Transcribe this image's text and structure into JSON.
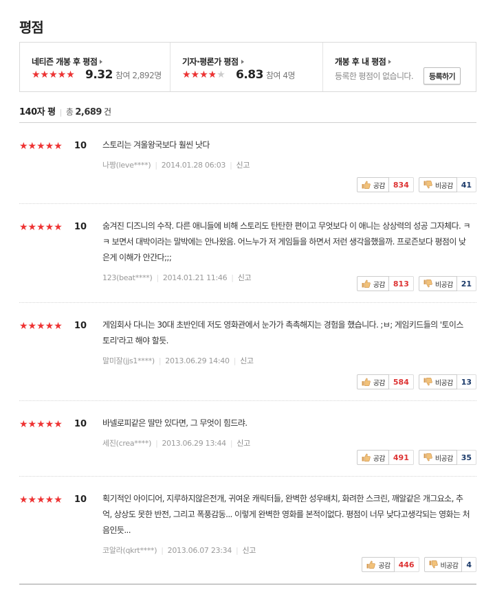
{
  "page_title": "평점",
  "summary": {
    "netizen": {
      "title": "네티즌 개봉 후 평점",
      "score": "9.32",
      "participants": "참여 2,892명",
      "score_fraction": 0.932
    },
    "critic": {
      "title": "기자·평론가 평점",
      "score": "6.83",
      "participants": "참여 4명",
      "score_fraction": 0.683
    },
    "mine": {
      "title": "개봉 후 내 평점",
      "empty_text": "등록한 평점이 없습니다.",
      "register_label": "등록하기"
    }
  },
  "count_line": {
    "label": "140자 평",
    "total_label": "총",
    "total": "2,689",
    "unit": "건"
  },
  "colors": {
    "star": "#ee3333",
    "like_count": "#dd3333",
    "dislike_count": "#1b3a6a"
  },
  "icons": {
    "like": "thumbs-up-icon",
    "dislike": "thumbs-down-icon",
    "star": "star-icon",
    "arrow": "caret-right-icon"
  },
  "vote_labels": {
    "like": "공감",
    "dislike": "비공감"
  },
  "meta_report": "신고",
  "reviews": [
    {
      "stars": "★★★★★",
      "score": "10",
      "text": "스토리는 겨울왕국보다 훨씬 낫다",
      "author": "나짱(leve****)",
      "date": "2014.01.28 06:03",
      "likes": "834",
      "dislikes": "41"
    },
    {
      "stars": "★★★★★",
      "score": "10",
      "text": "숨겨진 디즈니의 수작. 다른 애니들에 비해 스토리도 탄탄한 편이고 무엇보다 이 애니는 상상력의 성공 그자체다. ㅋㅋ 보면서 대박이라는 말박에는 안나왔음. 어느누가 저 게임들을 하면서 저런 생각을했을까. 프로즌보다 평점이 낮은게 이해가 안간다;;;",
      "author": "123(beat****)",
      "date": "2014.01.21 11:46",
      "likes": "813",
      "dislikes": "21"
    },
    {
      "stars": "★★★★★",
      "score": "10",
      "text": "게임회사 다니는 30대 초반인데 저도 영화관에서 눈가가 촉촉해지는 경험을 했습니다. ;ㅂ; 게임키드들의 '토이스토리'라고 해야 할듯.",
      "author": "말미잘(jjs1****)",
      "date": "2013.06.29 14:40",
      "likes": "584",
      "dislikes": "13"
    },
    {
      "stars": "★★★★★",
      "score": "10",
      "text": "바넬로피같은 딸만 있다면, 그 무엇이 힘드랴.",
      "author": "세진(crea****)",
      "date": "2013.06.29 13:44",
      "likes": "491",
      "dislikes": "35"
    },
    {
      "stars": "★★★★★",
      "score": "10",
      "text": "획기적인 아이디어, 지루하지않은전개, 귀여운 캐릭터들, 완벽한 성우배치, 화려한 스크린, 깨알같은 개그요소, 추억, 상상도 못한 반전, 그리고 폭풍감동... 이렇게 완벽한 영화를 본적이없다. 평점이 너무 낮다고생각되는 영화는 처음인듯...",
      "author": "코알라(qkrt****)",
      "date": "2013.06.07 23:34",
      "likes": "446",
      "dislikes": "4"
    }
  ]
}
